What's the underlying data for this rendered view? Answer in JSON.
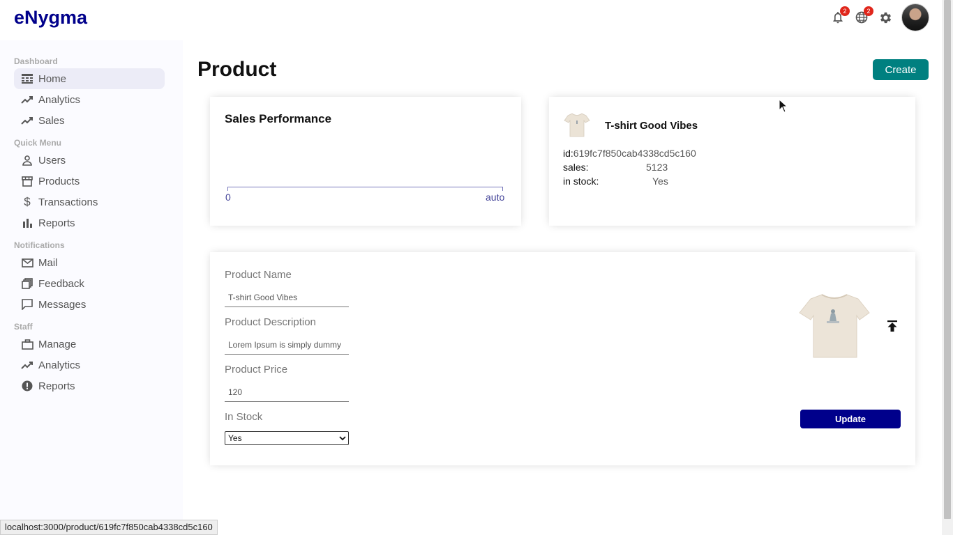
{
  "app": {
    "logo": "eNygma"
  },
  "topbar": {
    "notifications_count": "2",
    "language_count": "2",
    "icons": [
      "bell-icon",
      "globe-icon",
      "gear-icon",
      "avatar"
    ]
  },
  "sidebar": {
    "sections": [
      {
        "title": "Dashboard",
        "items": [
          {
            "label": "Home",
            "icon": "home-icon"
          },
          {
            "label": "Analytics",
            "icon": "trending-icon"
          },
          {
            "label": "Sales",
            "icon": "trending-icon"
          }
        ]
      },
      {
        "title": "Quick Menu",
        "items": [
          {
            "label": "Users",
            "icon": "user-icon"
          },
          {
            "label": "Products",
            "icon": "store-icon"
          },
          {
            "label": "Transactions",
            "icon": "dollar-icon"
          },
          {
            "label": "Reports",
            "icon": "bar-chart-icon"
          }
        ]
      },
      {
        "title": "Notifications",
        "items": [
          {
            "label": "Mail",
            "icon": "mail-icon"
          },
          {
            "label": "Feedback",
            "icon": "feedback-icon"
          },
          {
            "label": "Messages",
            "icon": "chat-icon"
          }
        ]
      },
      {
        "title": "Staff",
        "items": [
          {
            "label": "Manage",
            "icon": "briefcase-icon"
          },
          {
            "label": "Analytics",
            "icon": "trending-icon"
          },
          {
            "label": "Reports",
            "icon": "report-icon"
          }
        ]
      }
    ]
  },
  "page": {
    "title": "Product",
    "create_label": "Create"
  },
  "chart": {
    "title": "Sales Performance",
    "axis_min": "0",
    "axis_max": "auto"
  },
  "info": {
    "name": "T-shirt Good Vibes",
    "id_label": "id:",
    "id_value": "619fc7f850cab4338cd5c160",
    "sales_label": "sales:",
    "sales_value": "5123",
    "stock_label": "in stock:",
    "stock_value": "Yes"
  },
  "form": {
    "name_label": "Product Name",
    "name_value": "T-shirt Good Vibes",
    "desc_label": "Product Description",
    "desc_value": "Lorem Ipsum is simply dummy",
    "price_label": "Product Price",
    "price_value": "120",
    "stock_label": "In Stock",
    "stock_selected": "Yes",
    "update_label": "Update"
  },
  "status_bar": {
    "url": "localhost:3000/product/619fc7f850cab4338cd5c160"
  },
  "colors": {
    "brand": "#00008b",
    "create_button": "#008080",
    "badge": "#e0261b"
  }
}
